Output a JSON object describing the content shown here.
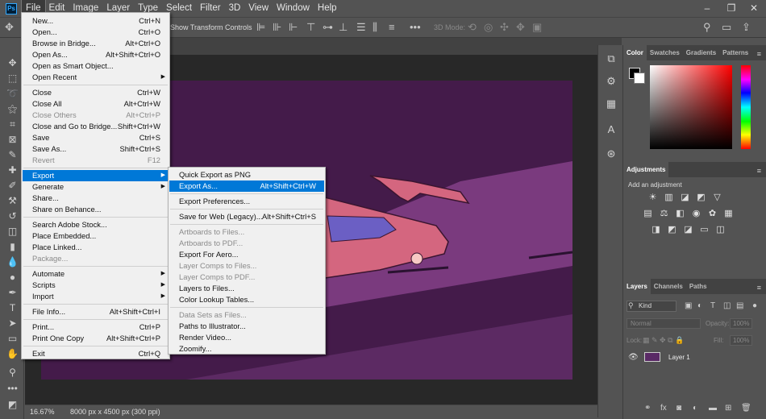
{
  "menubar": {
    "app_logo": "Ps",
    "items": [
      "File",
      "Edit",
      "Image",
      "Layer",
      "Type",
      "Select",
      "Filter",
      "3D",
      "View",
      "Window",
      "Help"
    ],
    "window_controls": [
      "–",
      "❐",
      "✕"
    ]
  },
  "options_bar": {
    "show_transform_label": "Show Transform Controls",
    "mode_3d_label": "3D Mode:"
  },
  "status": {
    "zoom": "16.67%",
    "doc_info": "8000 px x 4500 px (300 ppi)"
  },
  "file_menu": [
    {
      "label": "New...",
      "shortcut": "Ctrl+N"
    },
    {
      "label": "Open...",
      "shortcut": "Ctrl+O"
    },
    {
      "label": "Browse in Bridge...",
      "shortcut": "Alt+Ctrl+O"
    },
    {
      "label": "Open As...",
      "shortcut": "Alt+Shift+Ctrl+O"
    },
    {
      "label": "Open as Smart Object..."
    },
    {
      "label": "Open Recent",
      "submenu": true
    },
    {
      "label": "Close",
      "shortcut": "Ctrl+W"
    },
    {
      "label": "Close All",
      "shortcut": "Alt+Ctrl+W"
    },
    {
      "label": "Close Others",
      "shortcut": "Alt+Ctrl+P",
      "disabled": true
    },
    {
      "label": "Close and Go to Bridge...",
      "shortcut": "Shift+Ctrl+W"
    },
    {
      "label": "Save",
      "shortcut": "Ctrl+S"
    },
    {
      "label": "Save As...",
      "shortcut": "Shift+Ctrl+S"
    },
    {
      "label": "Revert",
      "shortcut": "F12",
      "disabled": true
    },
    {
      "label": "Export",
      "submenu": true,
      "highlighted": true
    },
    {
      "label": "Generate",
      "submenu": true
    },
    {
      "label": "Share..."
    },
    {
      "label": "Share on Behance..."
    },
    {
      "label": "Search Adobe Stock..."
    },
    {
      "label": "Place Embedded..."
    },
    {
      "label": "Place Linked..."
    },
    {
      "label": "Package...",
      "disabled": true
    },
    {
      "label": "Automate",
      "submenu": true
    },
    {
      "label": "Scripts",
      "submenu": true
    },
    {
      "label": "Import",
      "submenu": true
    },
    {
      "label": "File Info...",
      "shortcut": "Alt+Shift+Ctrl+I"
    },
    {
      "label": "Print...",
      "shortcut": "Ctrl+P"
    },
    {
      "label": "Print One Copy",
      "shortcut": "Alt+Shift+Ctrl+P"
    },
    {
      "label": "Exit",
      "shortcut": "Ctrl+Q"
    }
  ],
  "export_menu": [
    {
      "label": "Quick Export as PNG"
    },
    {
      "label": "Export As...",
      "shortcut": "Alt+Shift+Ctrl+W",
      "highlighted": true
    },
    {
      "label": "Export Preferences..."
    },
    {
      "label": "Save for Web (Legacy)...",
      "shortcut": "Alt+Shift+Ctrl+S"
    },
    {
      "label": "Artboards to Files...",
      "disabled": true
    },
    {
      "label": "Artboards to PDF...",
      "disabled": true
    },
    {
      "label": "Export For Aero..."
    },
    {
      "label": "Layer Comps to Files...",
      "disabled": true
    },
    {
      "label": "Layer Comps to PDF...",
      "disabled": true
    },
    {
      "label": "Layers to Files..."
    },
    {
      "label": "Color Lookup Tables..."
    },
    {
      "label": "Data Sets as Files...",
      "disabled": true
    },
    {
      "label": "Paths to Illustrator..."
    },
    {
      "label": "Render Video..."
    },
    {
      "label": "Zoomify..."
    }
  ],
  "color_panel": {
    "tabs": [
      "Color",
      "Swatches",
      "Gradients",
      "Patterns"
    ],
    "foreground": "#000000",
    "background": "#ffffff"
  },
  "adjustments_panel": {
    "title": "Adjustments",
    "hint": "Add an adjustment"
  },
  "layers_panel": {
    "tabs": [
      "Layers",
      "Channels",
      "Paths"
    ],
    "filter_kind": "Kind",
    "blend_mode": "Normal",
    "opacity_label": "Opacity:",
    "opacity": "100%",
    "lock_label": "Lock:",
    "fill_label": "Fill:",
    "fill": "100%",
    "layers": [
      {
        "name": "Layer 1",
        "visible": true
      }
    ]
  },
  "colors": {
    "ui_bg": "#535353",
    "menu_highlight": "#0078d7",
    "artboard_bg": "#441b4a",
    "road": "#7a3a7e",
    "car": "#d4667f"
  }
}
